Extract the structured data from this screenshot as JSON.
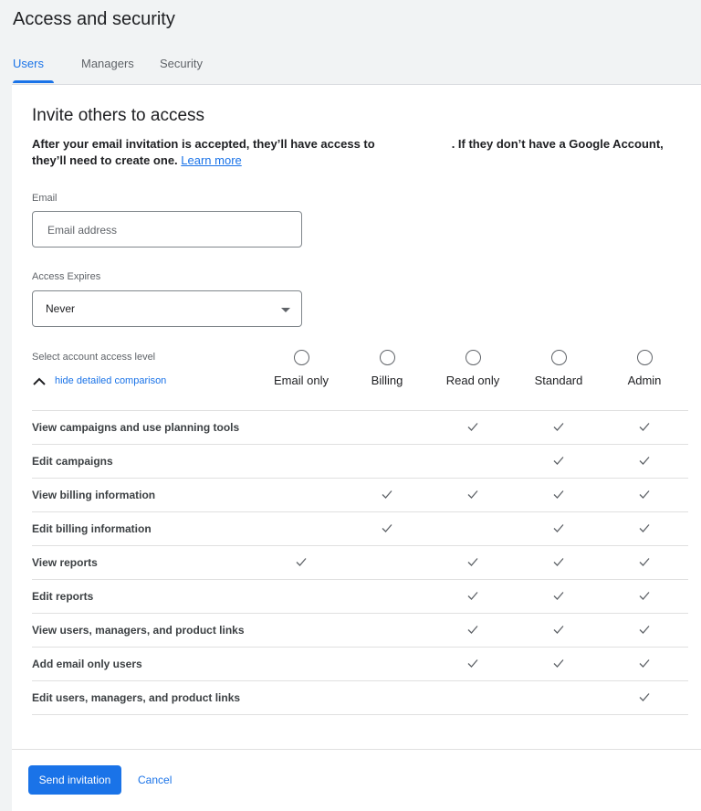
{
  "header": {
    "title": "Access and security"
  },
  "tabs": [
    {
      "label": "Users",
      "active": true
    },
    {
      "label": "Managers",
      "active": false
    },
    {
      "label": "Security",
      "active": false
    }
  ],
  "invite": {
    "title": "Invite others to access",
    "desc_part1": "After your email invitation is accepted, they’ll have access to",
    "desc_part2": ". If they don’t have a Google Account, they’ll need to create one.",
    "learn_more": "Learn more"
  },
  "email": {
    "label": "Email",
    "placeholder": "Email address",
    "value": ""
  },
  "expires": {
    "label": "Access Expires",
    "value": "Never"
  },
  "access": {
    "label": "Select account access level",
    "toggle_label": "hide detailed comparison",
    "levels": [
      "Email only",
      "Billing",
      "Read only",
      "Standard",
      "Admin"
    ],
    "permissions": [
      {
        "label": "View campaigns and use planning tools",
        "checks": [
          false,
          false,
          true,
          true,
          true
        ]
      },
      {
        "label": "Edit campaigns",
        "checks": [
          false,
          false,
          false,
          true,
          true
        ]
      },
      {
        "label": "View billing information",
        "checks": [
          false,
          true,
          true,
          true,
          true
        ]
      },
      {
        "label": "Edit billing information",
        "checks": [
          false,
          true,
          false,
          true,
          true
        ]
      },
      {
        "label": "View reports",
        "checks": [
          true,
          false,
          true,
          true,
          true
        ]
      },
      {
        "label": "Edit reports",
        "checks": [
          false,
          false,
          true,
          true,
          true
        ]
      },
      {
        "label": "View users, managers, and product links",
        "checks": [
          false,
          false,
          true,
          true,
          true
        ]
      },
      {
        "label": "Add email only users",
        "checks": [
          false,
          false,
          true,
          true,
          true
        ]
      },
      {
        "label": "Edit users, managers, and product links",
        "checks": [
          false,
          false,
          false,
          false,
          true
        ]
      }
    ]
  },
  "actions": {
    "send_label": "Send invitation",
    "cancel_label": "Cancel"
  },
  "colors": {
    "accent": "#1a73e8",
    "text": "#202124",
    "muted": "#5f6368",
    "divider": "#e0e0e0"
  },
  "icons": {
    "check": "check-icon",
    "dropdown": "dropdown-arrow-icon",
    "toggle": "chevron-up-icon"
  }
}
